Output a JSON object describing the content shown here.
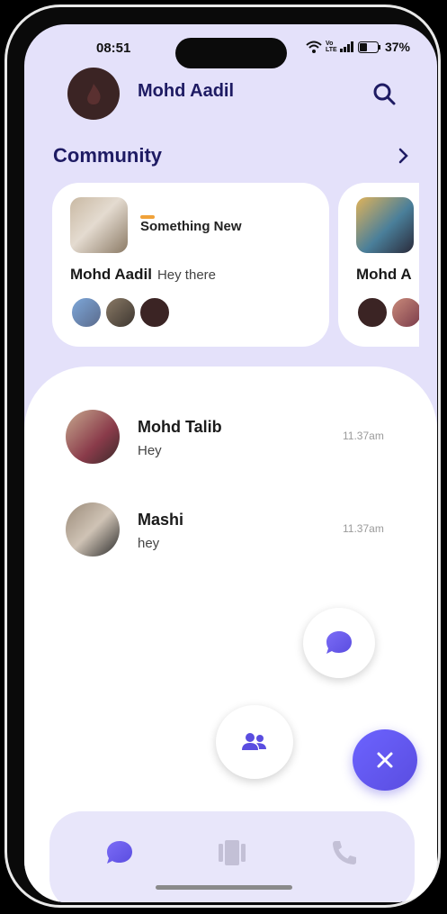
{
  "status_bar": {
    "time": "08:51",
    "battery": "37%",
    "network_label": "Vo LTE"
  },
  "header": {
    "username": "Mohd Aadil"
  },
  "community": {
    "title": "Community",
    "cards": [
      {
        "tag": "Something New",
        "name": "Mohd Aadil",
        "message": "Hey there"
      },
      {
        "name": "Mohd A"
      }
    ]
  },
  "chats": [
    {
      "name": "Mohd Talib",
      "message": "Hey",
      "time": "11.37am"
    },
    {
      "name": "Mashi",
      "message": "hey",
      "time": "11.37am"
    }
  ],
  "colors": {
    "accent": "#5a4de0",
    "background": "#e4e1fa",
    "title": "#1e1b63",
    "tag": "#f0a23a"
  }
}
